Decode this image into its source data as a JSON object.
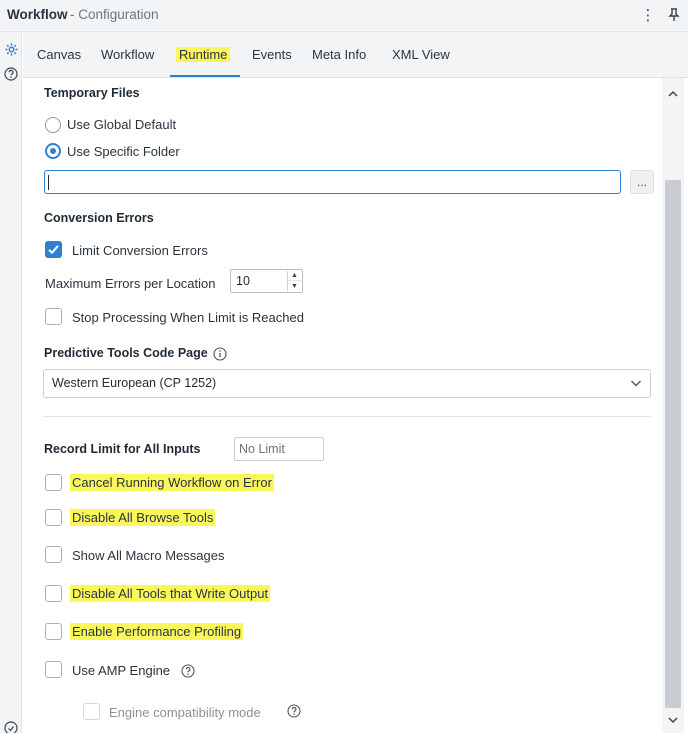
{
  "window": {
    "title_main": "Workflow",
    "title_sub": " - Configuration"
  },
  "tabs": [
    {
      "label": "Canvas"
    },
    {
      "label": "Workflow"
    },
    {
      "label": "Runtime"
    },
    {
      "label": "Events"
    },
    {
      "label": "Meta Info"
    },
    {
      "label": "XML View"
    }
  ],
  "active_tab": "Runtime",
  "temp_files": {
    "label": "Temporary Files",
    "global_default": "Use Global Default",
    "specific_folder": "Use Specific Folder",
    "selected": "Use Specific Folder",
    "folder_value": "",
    "browse_label": "..."
  },
  "conversion": {
    "label": "Conversion Errors",
    "limit_label": "Limit Conversion Errors",
    "limit_checked": true,
    "max_label": "Maximum Errors per Location",
    "max_value": "10",
    "stop_label": "Stop Processing When Limit is Reached",
    "stop_checked": false
  },
  "predictive": {
    "label": "Predictive Tools Code Page",
    "value": "Western European (CP 1252)"
  },
  "record_limit": {
    "label": "Record Limit for All Inputs",
    "placeholder": "No Limit"
  },
  "options": {
    "cancel": "Cancel Running Workflow on Error",
    "disable_browse": "Disable All Browse Tools",
    "show_macro": "Show All Macro Messages",
    "disable_output": "Disable All Tools that Write Output",
    "profiling": "Enable Performance Profiling",
    "amp": "Use AMP Engine",
    "compat": "Engine compatibility mode"
  },
  "colors": {
    "accent": "#2f7fd4",
    "highlight": "#fbf75a"
  }
}
